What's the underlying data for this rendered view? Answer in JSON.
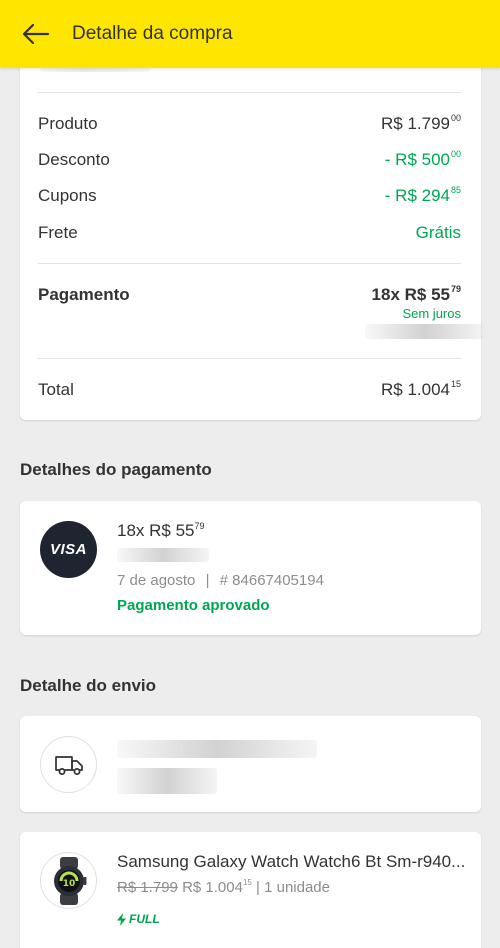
{
  "header": {
    "title": "Detalhe da compra"
  },
  "summary": {
    "product": {
      "label": "Produto",
      "main": "R$ 1.799",
      "cents": "00"
    },
    "discount": {
      "label": "Desconto",
      "main": "- R$ 500",
      "cents": "00"
    },
    "coupons": {
      "label": "Cupons",
      "main": "- R$ 294",
      "cents": "85"
    },
    "shipping": {
      "label": "Frete",
      "value": "Grátis"
    },
    "payment": {
      "label": "Pagamento",
      "main": "18x R$ 55",
      "cents": "79",
      "note": "Sem juros"
    },
    "total": {
      "label": "Total",
      "main": "R$ 1.004",
      "cents": "15"
    }
  },
  "payment_details": {
    "title": "Detalhes do pagamento",
    "card_brand": "VISA",
    "amount_main": "18x R$ 55",
    "amount_cents": "79",
    "date": "7 de agosto",
    "separator": "|",
    "operation": "# 84667405194",
    "status": "Pagamento aprovado"
  },
  "shipping_details": {
    "title": "Detalhe do envio"
  },
  "product": {
    "name": "Samsung Galaxy Watch Watch6 Bt Sm-r940...",
    "old_price": "R$ 1.799",
    "price_main": "R$ 1.004",
    "price_cents": "15",
    "quantity": "| 1 unidade",
    "badge": "FULL"
  },
  "colors": {
    "appbar": "#ffe600",
    "green": "#00a650",
    "text": "#333333",
    "muted": "#8c8c8c",
    "background": "#ededed"
  },
  "icons": [
    "arrow-left-icon",
    "visa-icon",
    "truck-icon",
    "watch-icon",
    "lightning-icon"
  ]
}
